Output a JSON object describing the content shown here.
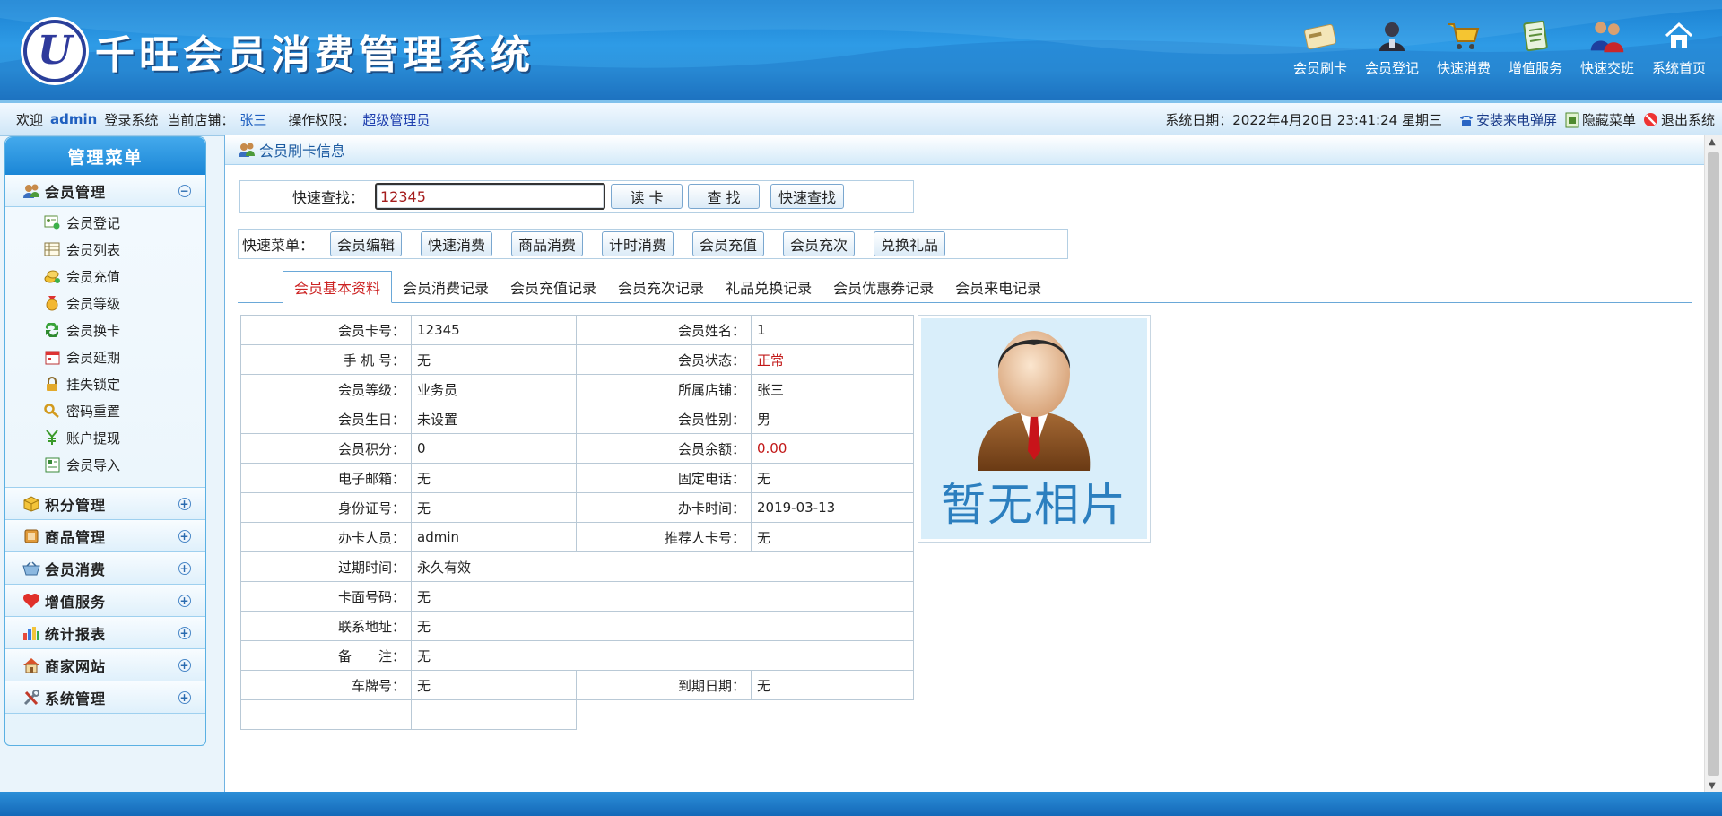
{
  "app": {
    "logo_glyph": "U",
    "title": "千旺会员消费管理系统"
  },
  "topnav": [
    {
      "label": "会员刷卡",
      "icon": "card-icon"
    },
    {
      "label": "会员登记",
      "icon": "user-register-icon"
    },
    {
      "label": "快速消费",
      "icon": "cart-icon"
    },
    {
      "label": "增值服务",
      "icon": "clipboard-icon"
    },
    {
      "label": "快速交班",
      "icon": "shift-users-icon"
    },
    {
      "label": "系统首页",
      "icon": "home-icon"
    }
  ],
  "infobar": {
    "welcome": "欢迎",
    "user": "admin",
    "login_text": "登录系统",
    "store_label": "当前店铺：",
    "store": "张三",
    "perm_label": "操作权限：",
    "perm": "超级管理员",
    "date": "系统日期：2022年4月20日 23:41:24 星期三",
    "install_popup": "安装来电弹屏",
    "hide_menu": "隐藏菜单",
    "logout": "退出系统"
  },
  "sidebar": {
    "title": "管理菜单",
    "member_group": {
      "label": "会员管理",
      "toggle": "−"
    },
    "member_items": [
      {
        "label": "会员登记",
        "icon": "register-icon"
      },
      {
        "label": "会员列表",
        "icon": "list-icon"
      },
      {
        "label": "会员充值",
        "icon": "coins-icon"
      },
      {
        "label": "会员等级",
        "icon": "medal-icon"
      },
      {
        "label": "会员换卡",
        "icon": "swap-icon"
      },
      {
        "label": "会员延期",
        "icon": "calendar-icon"
      },
      {
        "label": "挂失锁定",
        "icon": "lock-icon"
      },
      {
        "label": "密码重置",
        "icon": "key-icon"
      },
      {
        "label": "账户提现",
        "icon": "money-icon"
      },
      {
        "label": "会员导入",
        "icon": "import-icon"
      }
    ],
    "groups": [
      {
        "label": "积分管理",
        "toggle": "+",
        "icon": "box-icon"
      },
      {
        "label": "商品管理",
        "toggle": "+",
        "icon": "goods-icon"
      },
      {
        "label": "会员消费",
        "toggle": "+",
        "icon": "basket-icon"
      },
      {
        "label": "增值服务",
        "toggle": "+",
        "icon": "heart-icon"
      },
      {
        "label": "统计报表",
        "toggle": "+",
        "icon": "chart-icon"
      },
      {
        "label": "商家网站",
        "toggle": "+",
        "icon": "house-icon"
      },
      {
        "label": "系统管理",
        "toggle": "+",
        "icon": "tools-icon"
      }
    ]
  },
  "main": {
    "title": "会员刷卡信息",
    "search": {
      "label": "快速查找：",
      "value": "12345",
      "read_btn": "读  卡",
      "find_btn": "查  找",
      "quick_btn": "快速查找"
    },
    "quick_menu": {
      "label": "快速菜单：",
      "buttons": [
        "会员编辑",
        "快速消费",
        "商品消费",
        "计时消费",
        "会员充值",
        "会员充次",
        "兑换礼品"
      ]
    },
    "tabs": [
      "会员基本资料",
      "会员消费记录",
      "会员充值记录",
      "会员充次记录",
      "礼品兑换记录",
      "会员优惠券记录",
      "会员来电记录"
    ],
    "fields": {
      "card_no_k": "会员卡号：",
      "card_no": "12345",
      "name_k": "会员姓名：",
      "name": "1",
      "phone_k": "手 机 号：",
      "phone": "无",
      "status_k": "会员状态：",
      "status": "正常",
      "level_k": "会员等级：",
      "level": "业务员",
      "store_k": "所属店铺：",
      "store": "张三",
      "birthday_k": "会员生日：",
      "birthday": "未设置",
      "gender_k": "会员性别：",
      "gender": "男",
      "points_k": "会员积分：",
      "points": "0",
      "balance_k": "会员余额：",
      "balance": "0.00",
      "email_k": "电子邮箱：",
      "email": "无",
      "tel_k": "固定电话：",
      "tel": "无",
      "idcard_k": "身份证号：",
      "idcard": "无",
      "issue_k": "办卡时间：",
      "issue": "2019-03-13",
      "operator_k": "办卡人员：",
      "operator": "admin",
      "referrer_k": "推荐人卡号：",
      "referrer": "无",
      "expire_k": "过期时间：",
      "expire": "永久有效",
      "face_k": "卡面号码：",
      "face": "无",
      "address_k": "联系地址：",
      "address": "无",
      "remark_k": "备　　注：",
      "remark": "无",
      "plate_k": "车牌号：",
      "plate": "无",
      "due_k": "到期日期：",
      "due": "无"
    },
    "photo_text": "暂无相片"
  }
}
